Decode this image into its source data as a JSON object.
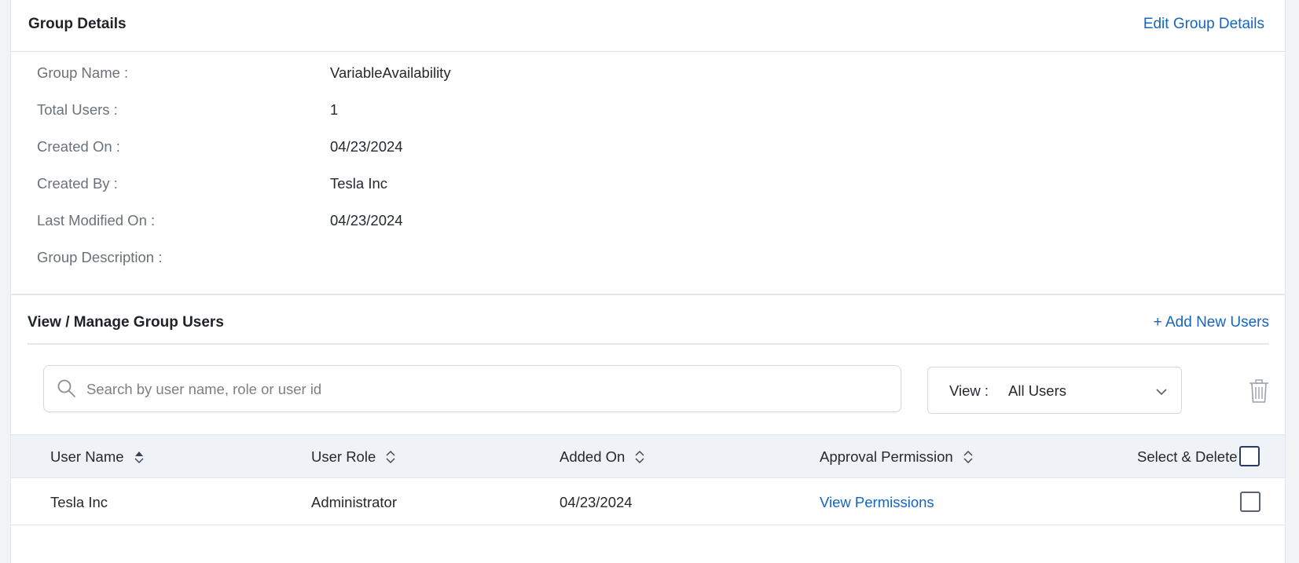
{
  "group_details": {
    "title": "Group Details",
    "edit_link": "Edit Group Details",
    "fields": [
      {
        "label": "Group Name :",
        "value": "VariableAvailability"
      },
      {
        "label": "Total Users :",
        "value": "1"
      },
      {
        "label": "Created On :",
        "value": "04/23/2024"
      },
      {
        "label": "Created By :",
        "value": "Tesla Inc"
      },
      {
        "label": "Last Modified On :",
        "value": "04/23/2024"
      },
      {
        "label": "Group Description :",
        "value": ""
      }
    ]
  },
  "users_section": {
    "title": "View / Manage Group Users",
    "add_link": "+ Add New Users"
  },
  "search": {
    "placeholder": "Search by user name, role or user id",
    "value": ""
  },
  "view_filter": {
    "label": "View :",
    "selected": "All Users"
  },
  "table": {
    "columns": [
      "User Name",
      "User Role",
      "Added On",
      "Approval Permission",
      "Select & Delete"
    ],
    "rows": [
      {
        "user_name": "Tesla Inc",
        "user_role": "Administrator",
        "added_on": "04/23/2024",
        "approval_permission": "View Permissions"
      }
    ]
  },
  "colors": {
    "link": "#1565c0",
    "table_header_bg": "#eff2f6",
    "label_gray": "#6b7178"
  },
  "icons": [
    "search-icon",
    "chevron-down-icon",
    "trash-icon",
    "sort-icon"
  ]
}
